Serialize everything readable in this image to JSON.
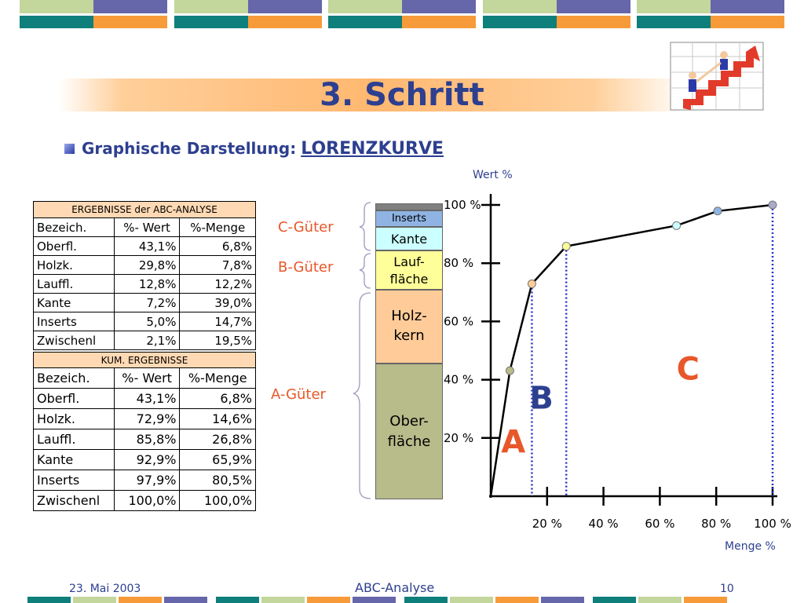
{
  "slide": {
    "title": "3. Schritt",
    "subtitle_prefix": "Graphische Darstellung:",
    "subtitle_link": "LORENZKURVE"
  },
  "table_results": {
    "caption": "ERGEBNISSE der ABC-ANALYSE",
    "headers": [
      "Bezeich.",
      "%- Wert",
      "%-Menge"
    ],
    "rows": [
      [
        "Oberfl.",
        "43,1%",
        "6,8%"
      ],
      [
        "Holzk.",
        "29,8%",
        "7,8%"
      ],
      [
        "Lauffl.",
        "12,8%",
        "12,2%"
      ],
      [
        "Kante",
        "7,2%",
        "39,0%"
      ],
      [
        "Inserts",
        "5,0%",
        "14,7%"
      ],
      [
        "Zwischenl",
        "2,1%",
        "19,5%"
      ]
    ]
  },
  "table_cumulative": {
    "caption": "KUM. ERGEBNISSE",
    "headers": [
      "Bezeich.",
      "%- Wert",
      "%-Menge"
    ],
    "rows": [
      [
        "Oberfl.",
        "43,1%",
        "6,8%"
      ],
      [
        "Holzk.",
        "72,9%",
        "14,6%"
      ],
      [
        "Lauffl.",
        "85,8%",
        "26,8%"
      ],
      [
        "Kante",
        "92,9%",
        "65,9%"
      ],
      [
        "Inserts",
        "97,9%",
        "80,5%"
      ],
      [
        "Zwischenl",
        "100,0%",
        "100,0%"
      ]
    ]
  },
  "groups": {
    "c": "C-Güter",
    "b": "B-Güter",
    "a": "A-Güter"
  },
  "stack_segments": {
    "inserts": "Inserts",
    "kante": "Kante",
    "lauf_1": "Lauf-",
    "lauf_2": "fläche",
    "holz_1": "Holz-",
    "holz_2": "kern",
    "ober_1": "Ober-",
    "ober_2": "fläche"
  },
  "colors": {
    "title": "#2d3f8f",
    "accent_orange": "#e8572a",
    "inserts_bg": "#8fb4e3",
    "kante_bg": "#ccffff",
    "lauf_bg": "#ffff99",
    "holz_bg": "#ffcc99",
    "ober_bg": "#b8bb8a",
    "zwischen_bg": "#808080"
  },
  "chart_data": {
    "type": "line",
    "ylabel": "Wert %",
    "xlabel": "Menge %",
    "x_ticks": [
      "20 %",
      "40 %",
      "60 %",
      "80 %",
      "100 %"
    ],
    "y_ticks": [
      "20 %",
      "40 %",
      "60 %",
      "80 %",
      "100 %"
    ],
    "xlim": [
      0,
      100
    ],
    "ylim": [
      0,
      100
    ],
    "x": [
      0,
      6.8,
      14.6,
      26.8,
      65.9,
      80.5,
      100
    ],
    "y": [
      0,
      43.1,
      72.9,
      85.8,
      92.9,
      97.9,
      100
    ],
    "class_boundaries_x": [
      14.6,
      26.8
    ],
    "class_labels": [
      "A",
      "B",
      "C"
    ],
    "class_label_positions_x": [
      8,
      18,
      70
    ],
    "class_label_positions_y": [
      15,
      30,
      40
    ]
  },
  "footer": {
    "date": "23. Mai 2003",
    "center": "ABC-Analyse",
    "page": "10"
  }
}
